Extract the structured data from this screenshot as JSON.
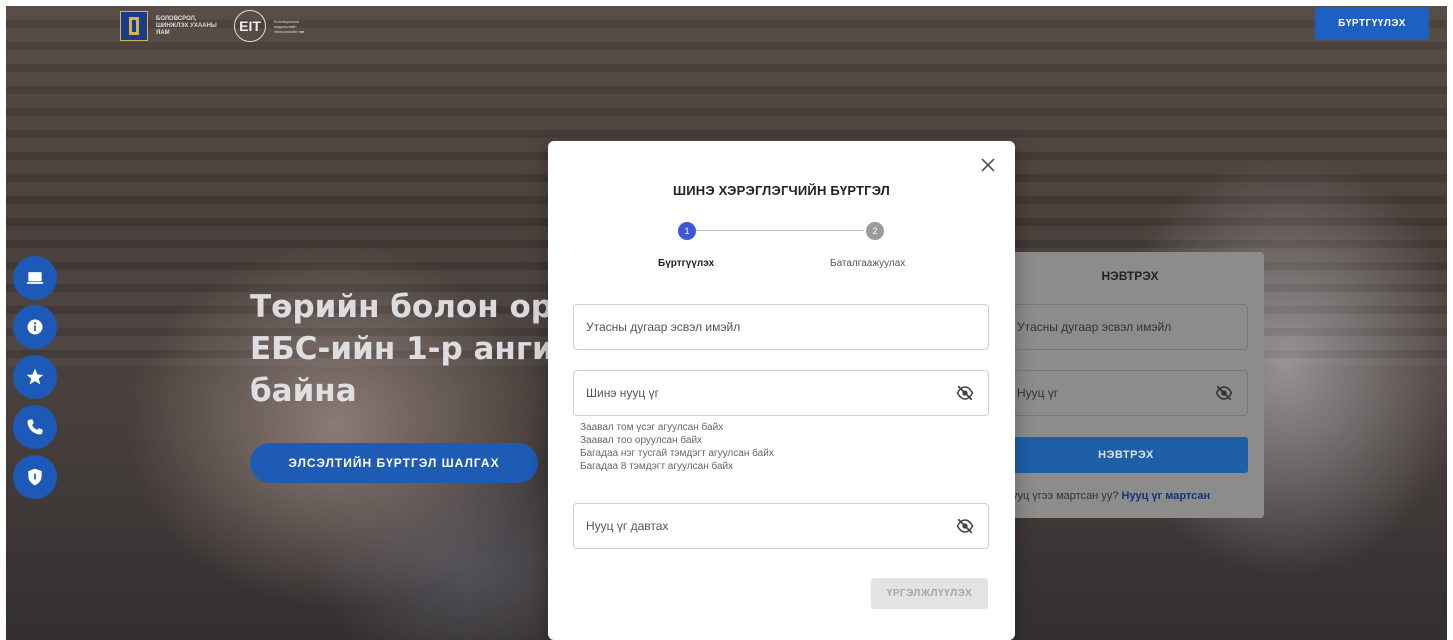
{
  "header": {
    "logo_text": "Боловсрол, шинжлэх ухааны яам",
    "eit_logo": "EIT",
    "eit_text": "Боловсролын мэдээллийн технологийн төв",
    "register_label": "БҮРТГҮҮЛЭХ"
  },
  "side_menu": [
    {
      "icon": "laptop-icon"
    },
    {
      "icon": "info-icon"
    },
    {
      "icon": "star-icon"
    },
    {
      "icon": "phone-icon"
    },
    {
      "icon": "shield-icon"
    }
  ],
  "hero": {
    "line1": "Төрийн болон ор",
    "line2": "ЕБС-ийн 1-р анги",
    "line3": "байна",
    "button_label": "ЭЛСЭЛТИЙН БҮРТГЭЛ ШАЛГАХ"
  },
  "login": {
    "title": "НЭВТРЭХ",
    "username_placeholder": "Утасны дугаар эсвэл имэйл",
    "password_placeholder": "Нууц үг",
    "button_label": "НЭВТРЭХ",
    "forgot_text": "Нууц үгээ мартсан уу?",
    "forgot_link": "Нууц үг мартсан"
  },
  "modal": {
    "title": "ШИНЭ ХЭРЭГЛЭГЧИЙН БҮРТГЭЛ",
    "steps": [
      {
        "number": "1",
        "label": "Бүртгүүлэх"
      },
      {
        "number": "2",
        "label": "Баталгаажуулах"
      }
    ],
    "contact_placeholder": "Утасны дугаар эсвэл имэйл",
    "password_placeholder": "Шинэ нууц үг",
    "hints": [
      "Заавал том үсэг агуулсан байх",
      "Заавал тоо оруулсан байх",
      "Багадаа нэг тусгай тэмдэгт агуулсан байх",
      "Багадаа 8 тэмдэгт агуулсан байх"
    ],
    "confirm_placeholder": "Нууц үг давтах",
    "continue_label": "ҮРГЭЛЖЛҮҮЛЭХ"
  },
  "colors": {
    "primary": "#1e5fc2",
    "step_active": "#3f57d6",
    "step_inactive": "#9b9b9b"
  }
}
